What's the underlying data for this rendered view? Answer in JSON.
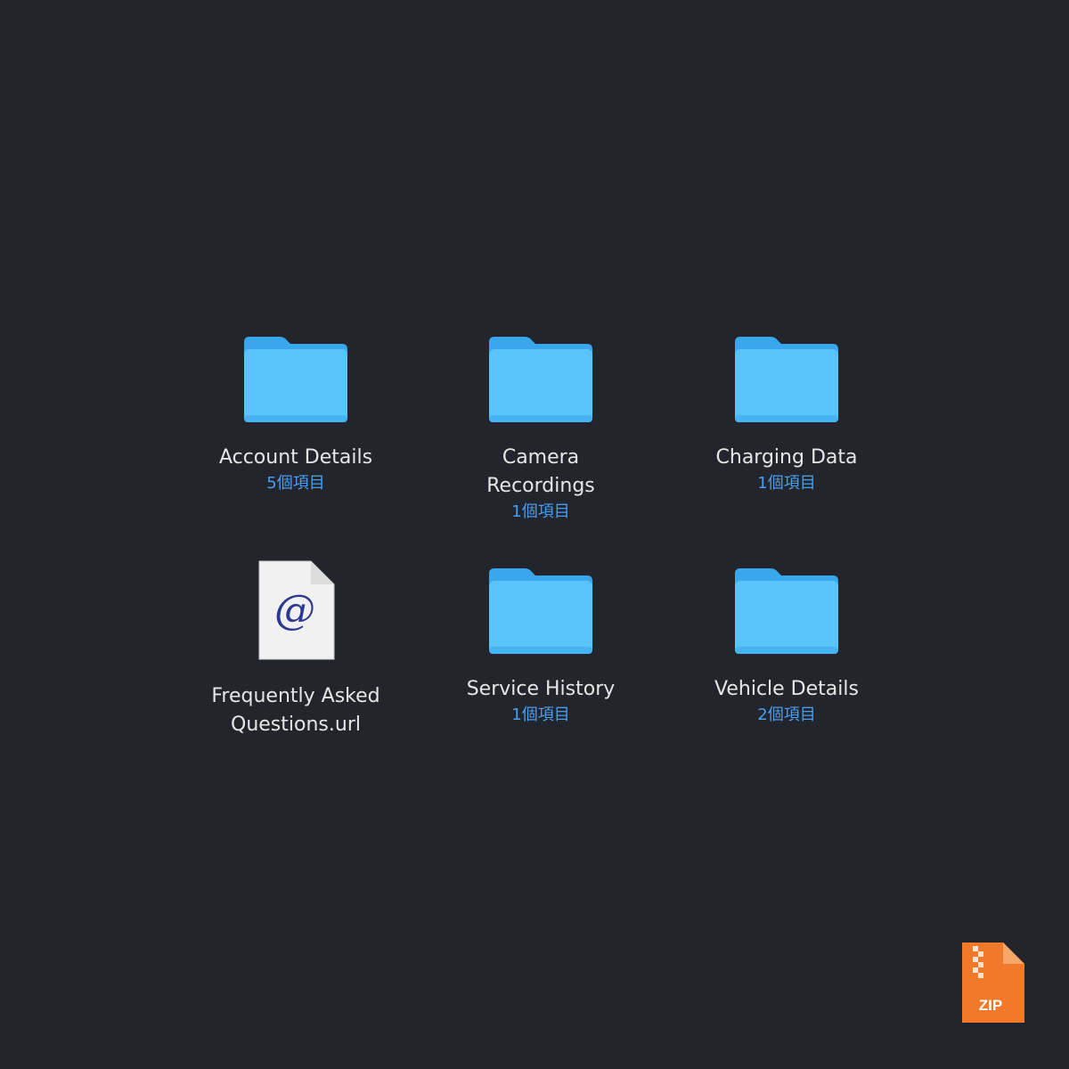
{
  "colors": {
    "background": "#22252b",
    "folder_body": "#58c4fa",
    "folder_tab": "#3aa6ec",
    "count_text": "#4a9df0",
    "name_text": "#e6e6e6",
    "zip_orange": "#f07a2a"
  },
  "items": [
    {
      "name": "Account Details",
      "count": "5個項目",
      "icon": "folder-icon"
    },
    {
      "name": "Camera Recordings",
      "count": "1個項目",
      "icon": "folder-icon"
    },
    {
      "name": "Charging Data",
      "count": "1個項目",
      "icon": "folder-icon"
    },
    {
      "name": "Frequently Asked Questions.url",
      "count": "",
      "icon": "url-document-icon",
      "glyph": "@"
    },
    {
      "name": "Service History",
      "count": "1個項目",
      "icon": "folder-icon"
    },
    {
      "name": "Vehicle Details",
      "count": "2個項目",
      "icon": "folder-icon"
    }
  ],
  "zip_badge": {
    "label": "ZIP",
    "icon": "zip-archive-icon"
  }
}
